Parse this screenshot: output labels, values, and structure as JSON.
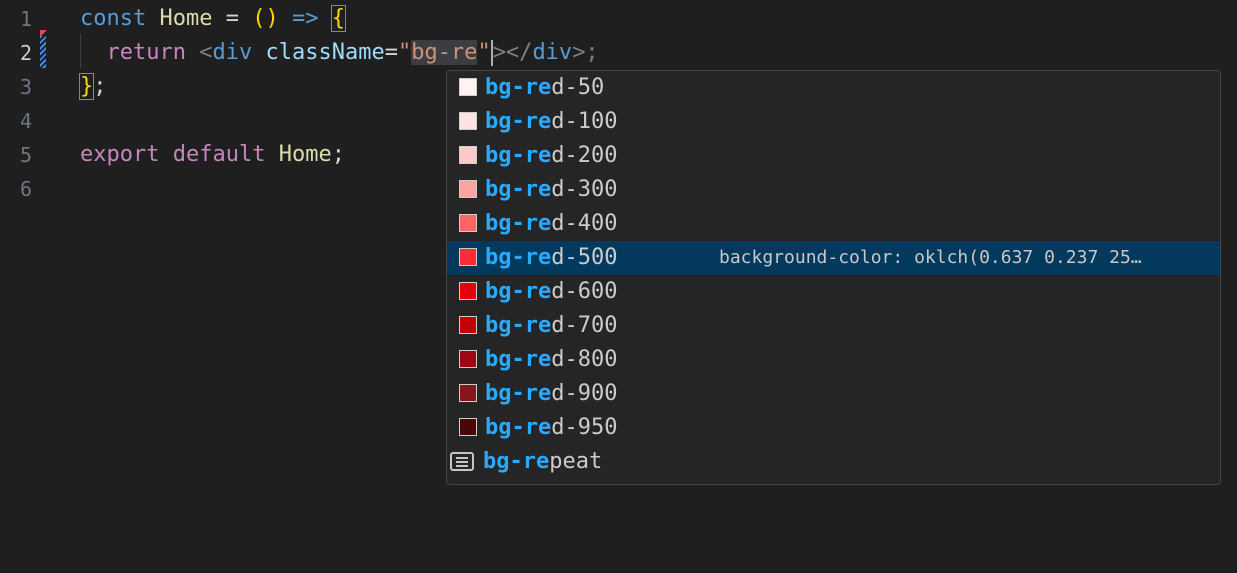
{
  "editor": {
    "line_numbers": [
      "1",
      "2",
      "3",
      "4",
      "5",
      "6"
    ],
    "active_line": "2",
    "lines": {
      "l1": {
        "const": "const",
        "name": "Home",
        "eq": " = ",
        "parens": "()",
        "arrow": " =>",
        "brace": "{"
      },
      "l2": {
        "return": "return",
        "lt": "<",
        "div": "div",
        "attr": "className",
        "eq": "=",
        "q1": "\"",
        "typed": "bg-re",
        "q2": "\"",
        "close": "></",
        "div2": "div",
        "gt": ">;"
      },
      "l3": {
        "brace": "}",
        "semi": ";"
      },
      "l5": {
        "export": "export",
        "default": "default",
        "name": "Home",
        "semi": ";"
      }
    }
  },
  "suggest": {
    "query": "bg-re",
    "selected_detail": "background-color: oklch(0.637 0.237 25…",
    "items": [
      {
        "match": "bg-re",
        "rest": "d-50",
        "color": "#fef2f2"
      },
      {
        "match": "bg-re",
        "rest": "d-100",
        "color": "#ffe2e2"
      },
      {
        "match": "bg-re",
        "rest": "d-200",
        "color": "#ffc9c9"
      },
      {
        "match": "bg-re",
        "rest": "d-300",
        "color": "#ffa2a2"
      },
      {
        "match": "bg-re",
        "rest": "d-400",
        "color": "#ff6467"
      },
      {
        "match": "bg-re",
        "rest": "d-500",
        "color": "#fb2c36"
      },
      {
        "match": "bg-re",
        "rest": "d-600",
        "color": "#e7000b"
      },
      {
        "match": "bg-re",
        "rest": "d-700",
        "color": "#c10007"
      },
      {
        "match": "bg-re",
        "rest": "d-800",
        "color": "#9f0712"
      },
      {
        "match": "bg-re",
        "rest": "d-900",
        "color": "#82181a"
      },
      {
        "match": "bg-re",
        "rest": "d-950",
        "color": "#460809"
      },
      {
        "match": "bg-re",
        "rest": "peat",
        "icon": "text-snippet-icon"
      }
    ]
  },
  "colors": {
    "editor_bg": "#1f1f1f",
    "widget_bg": "#252526",
    "selection_bg": "#04395e",
    "match_highlight": "#2aaaff"
  }
}
